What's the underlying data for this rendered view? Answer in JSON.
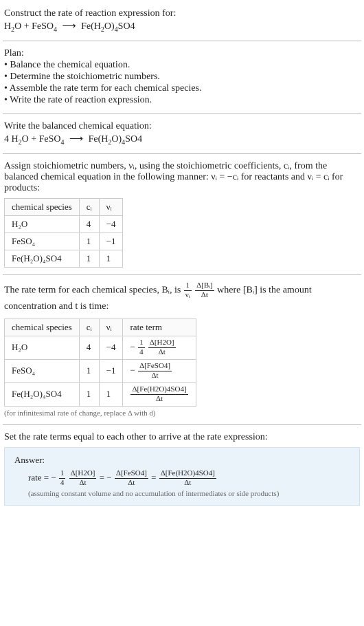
{
  "prompt": {
    "line1": "Construct the rate of reaction expression for:",
    "eq": {
      "lhs_a": "H",
      "lhs_a_sub": "2",
      "lhs_a2": "O + FeSO",
      "lhs_a2_sub": "4",
      "arrow": "⟶",
      "rhs": "Fe(H",
      "rhs_sub1": "2",
      "rhs2": "O)",
      "rhs_sub2": "4",
      "rhs3": "SO4"
    }
  },
  "plan": {
    "title": "Plan:",
    "items": [
      "• Balance the chemical equation.",
      "• Determine the stoichiometric numbers.",
      "• Assemble the rate term for each chemical species.",
      "• Write the rate of reaction expression."
    ]
  },
  "balanced": {
    "title": "Write the balanced chemical equation:",
    "coef1": "4 ",
    "t1a": "H",
    "t1a_sub": "2",
    "t1b": "O + FeSO",
    "t1b_sub": "4",
    "arrow": "⟶",
    "r1": "Fe(H",
    "r1_sub1": "2",
    "r2": "O)",
    "r2_sub2": "4",
    "r3": "SO4"
  },
  "assign": {
    "text": "Assign stoichiometric numbers, νᵢ, using the stoichiometric coefficients, cᵢ, from the balanced chemical equation in the following manner: νᵢ = −cᵢ for reactants and νᵢ = cᵢ for products:",
    "headers": {
      "a": "chemical species",
      "b": "cᵢ",
      "c": "νᵢ"
    },
    "rows": [
      {
        "sp": "H₂O",
        "c": "4",
        "v": "−4"
      },
      {
        "sp": "FeSO₄",
        "c": "1",
        "v": "−1"
      },
      {
        "sp": "Fe(H₂O)₄SO4",
        "c": "1",
        "v": "1"
      }
    ]
  },
  "rateterm": {
    "pre": "The rate term for each chemical species, Bᵢ, is ",
    "frac1": {
      "n": "1",
      "d": "νᵢ"
    },
    "frac2": {
      "n": "Δ[Bᵢ]",
      "d": "Δt"
    },
    "post": " where [Bᵢ] is the amount concentration and t is time:",
    "headers": {
      "a": "chemical species",
      "b": "cᵢ",
      "c": "νᵢ",
      "d": "rate term"
    },
    "rows": [
      {
        "sp": "H₂O",
        "c": "4",
        "v": "−4",
        "neg": "−",
        "f1n": "1",
        "f1d": "4",
        "f2n": "Δ[H2O]",
        "f2d": "Δt"
      },
      {
        "sp": "FeSO₄",
        "c": "1",
        "v": "−1",
        "neg": "−",
        "f1n": "",
        "f1d": "",
        "f2n": "Δ[FeSO4]",
        "f2d": "Δt"
      },
      {
        "sp": "Fe(H₂O)₄SO4",
        "c": "1",
        "v": "1",
        "neg": "",
        "f1n": "",
        "f1d": "",
        "f2n": "Δ[Fe(H2O)4SO4]",
        "f2d": "Δt"
      }
    ],
    "note": "(for infinitesimal rate of change, replace Δ with d)"
  },
  "setequal": "Set the rate terms equal to each other to arrive at the rate expression:",
  "answer": {
    "label": "Answer:",
    "lead": "rate = ",
    "t1_neg": "−",
    "t1_f1": {
      "n": "1",
      "d": "4"
    },
    "t1_f2": {
      "n": "Δ[H2O]",
      "d": "Δt"
    },
    "eq1": " = ",
    "t2_neg": "−",
    "t2_f": {
      "n": "Δ[FeSO4]",
      "d": "Δt"
    },
    "eq2": " = ",
    "t3_f": {
      "n": "Δ[Fe(H2O)4SO4]",
      "d": "Δt"
    },
    "note": "(assuming constant volume and no accumulation of intermediates or side products)"
  }
}
